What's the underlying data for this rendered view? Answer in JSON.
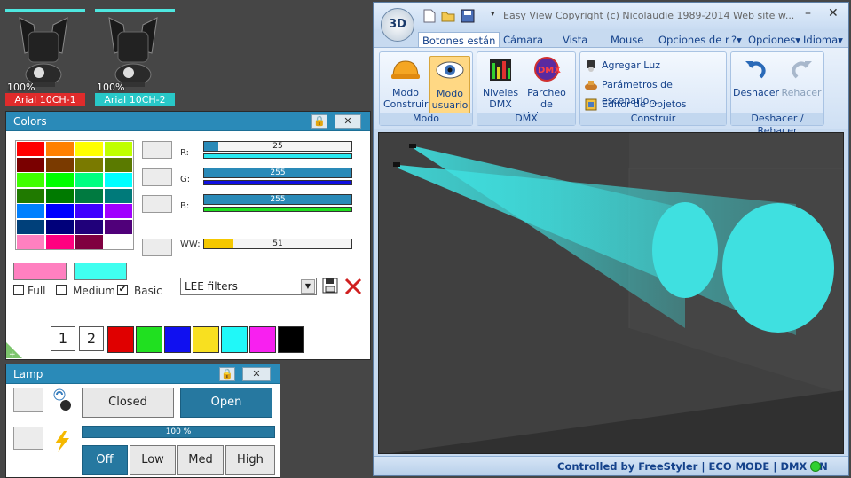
{
  "fixtures": [
    {
      "percent": "100%",
      "name": "Arial 10CH-1",
      "label_color": "#e02b2b"
    },
    {
      "percent": "100%",
      "name": "Arial 10CH-2",
      "label_color": "#28c8c8"
    }
  ],
  "colors_panel": {
    "title": "Colors",
    "lock_icon": "lock-icon",
    "close_icon": "close-icon",
    "palette": [
      [
        "#ff0000",
        "#ff8000",
        "#ffff00",
        "#c0ff00"
      ],
      [
        "#7a0000",
        "#7a3a00",
        "#7a7a00",
        "#5a7a00"
      ],
      [
        "#40ff00",
        "#00ff00",
        "#00ff80",
        "#00ffff"
      ],
      [
        "#207a00",
        "#007a00",
        "#007a40",
        "#007a7a"
      ],
      [
        "#0080ff",
        "#0000ff",
        "#4000ff",
        "#a000ff"
      ],
      [
        "#00407a",
        "#00007a",
        "#20007a",
        "#50007a"
      ],
      [
        "#ff80c0",
        "#ff0080",
        "#800040",
        "#ffffff"
      ]
    ],
    "channels": [
      {
        "label": "R:",
        "value": "25",
        "fraction": 0.098,
        "bar_color": "#2a8ab8",
        "track_color": "#29e8f0"
      },
      {
        "label": "G:",
        "value": "255",
        "fraction": 1.0,
        "bar_color": "#2a8ab8",
        "track_color": "#1010e0"
      },
      {
        "label": "B:",
        "value": "255",
        "fraction": 1.0,
        "bar_color": "#2a8ab8",
        "track_color": "#20e020"
      },
      {
        "label": "WW:",
        "value": "51",
        "fraction": 0.2,
        "bar_color": "#f5c800",
        "track_color": ""
      }
    ],
    "preview_left_color": "#ff80c0",
    "preview_right_color": "#40fff0",
    "options": [
      {
        "label": "Full",
        "checked": false
      },
      {
        "label": "Medium",
        "checked": false
      },
      {
        "label": "Basic",
        "checked": true
      }
    ],
    "filter_select": "LEE filters",
    "save_icon": "save-icon",
    "delete_icon": "delete-icon",
    "page_buttons": [
      "1",
      "2"
    ],
    "quick_colors": [
      "#e00000",
      "#20e020",
      "#1010f0",
      "#f8e020",
      "#20f8f8",
      "#f820f0",
      "#000000"
    ]
  },
  "lamp_panel": {
    "title": "Lamp",
    "shutter_closed": "Closed",
    "shutter_open": "Open",
    "intensity": "100 %",
    "intensity_fraction": 1.0,
    "power_modes": [
      "Off",
      "Low",
      "Med",
      "High"
    ],
    "active_mode": "Off"
  },
  "window": {
    "app_badge": "3D",
    "title": "Easy View   Copyright (c) Nicolaudie 1989-2014   Web site w...",
    "tabs": [
      "Botones están",
      "Cámara",
      "Vista",
      "Mouse",
      "Opciones de r"
    ],
    "right_menus": [
      "?",
      "Opciones",
      "Idioma"
    ],
    "groups": [
      {
        "label": "Modo",
        "buttons": [
          "Modo Construir",
          "Modo usuario"
        ]
      },
      {
        "label": "DMX",
        "buttons": [
          "Niveles DMX",
          "Parcheo de Universos"
        ]
      },
      {
        "label": "Construir",
        "items": [
          "Agregar Luz",
          "Parámetros de escenario...",
          "Editor de Objetos simples"
        ]
      },
      {
        "label": "Deshacer / Rehacer",
        "buttons": [
          "Deshacer",
          "Rehacer"
        ]
      }
    ],
    "status": "Controlled by FreeStyler  |  ECO MODE  |  DMX ON",
    "status_color": "#30d030",
    "beam_color": "#3fe0e0"
  }
}
